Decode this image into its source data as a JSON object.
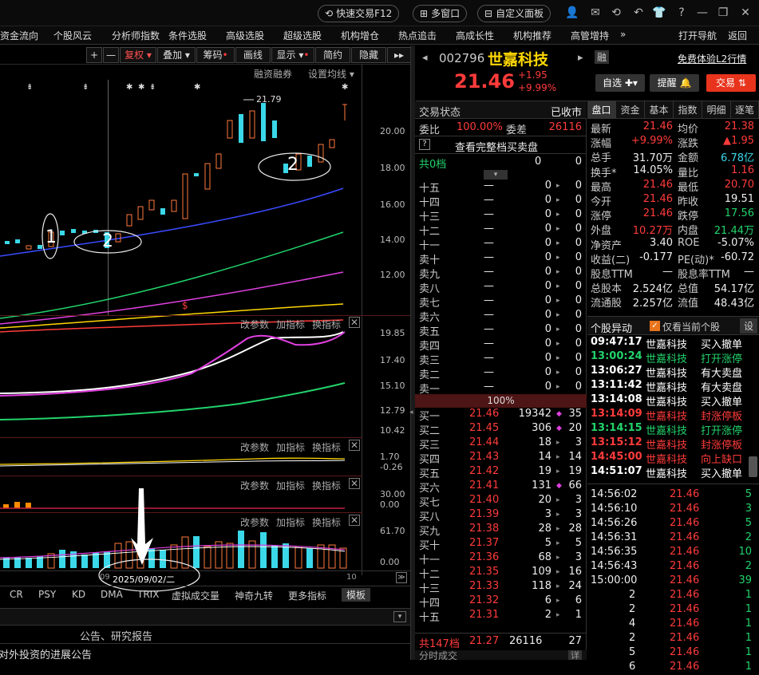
{
  "topbar": {
    "quick_trade": "快速交易F12",
    "multi_window": "多窗口",
    "custom_panel": "自定义面板"
  },
  "menu": [
    "资金流向",
    "个股风云",
    "分析师指数",
    "条件选股",
    "高级选股",
    "超级选股",
    "机构增仓",
    "热点追击",
    "高成长性",
    "机构推荐",
    "高管增持",
    "»",
    "打开导航",
    "返回"
  ],
  "chart_toolbar": {
    "plus": "+",
    "minus": "—",
    "fuquan": "复权",
    "overlay": "叠加",
    "chips": "筹码",
    "draw": "画线",
    "display": "显示",
    "simple": "简约",
    "hide": "隐藏",
    "more": "▸▸"
  },
  "chart_header": {
    "margin_trading": "融资融券",
    "ma_settings": "设置均线"
  },
  "price_axis": [
    "20.00",
    "18.00",
    "16.00",
    "14.00",
    "12.00"
  ],
  "annotations": {
    "high_label": "21.79",
    "dollar": "$",
    "circle1": "1",
    "circle2": "2"
  },
  "indicator_panels": [
    {
      "params": "改参数",
      "add": "加指标",
      "swap": "换指标",
      "axis": [
        "19.85",
        "17.40",
        "15.10",
        "12.79",
        "10.42"
      ]
    },
    {
      "params": "改参数",
      "add": "加指标",
      "swap": "换指标",
      "axis": [
        "1.70",
        "-0.26"
      ]
    },
    {
      "params": "改参数",
      "add": "加指标",
      "swap": "换指标",
      "axis": [
        "30.00",
        "0.00"
      ]
    },
    {
      "params": "改参数",
      "add": "加指标",
      "swap": "换指标",
      "axis": [
        "61.70",
        "0.00"
      ]
    }
  ],
  "x_axis": {
    "date_label": "2025/09/02/二",
    "right_label": "10",
    "left_label": "09"
  },
  "indicator_tabs": [
    "CR",
    "PSY",
    "KD",
    "DMA",
    "TRIX",
    "虚拟成交量",
    "神奇九转",
    "更多指标",
    "模板"
  ],
  "bottom_panel": {
    "title": "公告、研究报告",
    "item": "对外投资的进展公告"
  },
  "stock": {
    "code": "002796",
    "name": "世嘉科技",
    "tag": "融",
    "l2_link": "免费体验L2行情",
    "price": "21.46",
    "change": "+1.95",
    "change_pct": "+9.99%",
    "btn_watch": "自选",
    "btn_alert": "提醒",
    "btn_trade": "交易"
  },
  "order_book": {
    "status_label": "交易状态",
    "status_value": "已收市",
    "weibi_label": "委比",
    "weibi_value": "100.00%",
    "weicha_label": "委差",
    "weicha_value": "26116",
    "full_book_label": "查看完整档买卖盘",
    "sell_total_label": "共0档",
    "sell_total_v1": "0",
    "sell_total_v2": "0",
    "sells": [
      {
        "label": "十五",
        "price": "—",
        "vol": "0",
        "cnt": "0"
      },
      {
        "label": "十四",
        "price": "—",
        "vol": "0",
        "cnt": "0"
      },
      {
        "label": "十三",
        "price": "—",
        "vol": "0",
        "cnt": "0"
      },
      {
        "label": "十二",
        "price": "—",
        "vol": "0",
        "cnt": "0"
      },
      {
        "label": "十一",
        "price": "—",
        "vol": "0",
        "cnt": "0"
      },
      {
        "label": "卖十",
        "price": "—",
        "vol": "0",
        "cnt": "0"
      },
      {
        "label": "卖九",
        "price": "—",
        "vol": "0",
        "cnt": "0"
      },
      {
        "label": "卖八",
        "price": "—",
        "vol": "0",
        "cnt": "0"
      },
      {
        "label": "卖七",
        "price": "—",
        "vol": "0",
        "cnt": "0"
      },
      {
        "label": "卖六",
        "price": "—",
        "vol": "0",
        "cnt": "0"
      },
      {
        "label": "卖五",
        "price": "—",
        "vol": "0",
        "cnt": "0"
      },
      {
        "label": "卖四",
        "price": "—",
        "vol": "0",
        "cnt": "0"
      },
      {
        "label": "卖三",
        "price": "—",
        "vol": "0",
        "cnt": "0"
      },
      {
        "label": "卖二",
        "price": "—",
        "vol": "0",
        "cnt": "0"
      },
      {
        "label": "卖一",
        "price": "—",
        "vol": "0",
        "cnt": "0"
      }
    ],
    "ratio_bar": "100%",
    "buys": [
      {
        "label": "买一",
        "price": "21.46",
        "vol": "19342",
        "cnt": "35"
      },
      {
        "label": "买二",
        "price": "21.45",
        "vol": "306",
        "cnt": "20"
      },
      {
        "label": "买三",
        "price": "21.44",
        "vol": "18",
        "cnt": "3"
      },
      {
        "label": "买四",
        "price": "21.43",
        "vol": "14",
        "cnt": "14"
      },
      {
        "label": "买五",
        "price": "21.42",
        "vol": "19",
        "cnt": "19"
      },
      {
        "label": "买六",
        "price": "21.41",
        "vol": "131",
        "cnt": "66"
      },
      {
        "label": "买七",
        "price": "21.40",
        "vol": "20",
        "cnt": "3"
      },
      {
        "label": "买八",
        "price": "21.39",
        "vol": "3",
        "cnt": "3"
      },
      {
        "label": "买九",
        "price": "21.38",
        "vol": "28",
        "cnt": "28"
      },
      {
        "label": "买十",
        "price": "21.37",
        "vol": "5",
        "cnt": "5"
      },
      {
        "label": "十一",
        "price": "21.36",
        "vol": "68",
        "cnt": "3"
      },
      {
        "label": "十二",
        "price": "21.35",
        "vol": "109",
        "cnt": "16"
      },
      {
        "label": "十三",
        "price": "21.33",
        "vol": "118",
        "cnt": "24"
      },
      {
        "label": "十四",
        "price": "21.32",
        "vol": "6",
        "cnt": "6"
      },
      {
        "label": "十五",
        "price": "21.31",
        "vol": "2",
        "cnt": "1"
      }
    ],
    "buy_total_label": "共147档",
    "buy_total_price": "21.27",
    "buy_total_vol": "26116",
    "buy_total_cnt": "27",
    "tick_footer": "分时成交"
  },
  "quote_tabs": [
    "盘口",
    "资金",
    "基本",
    "指数",
    "明细",
    "逐笔"
  ],
  "quote": [
    {
      "l1": "最新",
      "v1": "21.46",
      "l2": "均价",
      "v2": "21.38"
    },
    {
      "l1": "涨幅",
      "v1": "+9.99%",
      "l2": "涨跌",
      "v2": "▲1.95"
    },
    {
      "l1": "总手",
      "v1": "31.70万",
      "l2": "金额",
      "v2": "6.78亿"
    },
    {
      "l1": "换手*",
      "v1": "14.05%",
      "l2": "量比",
      "v2": "1.16"
    },
    {
      "l1": "最高",
      "v1": "21.46",
      "l2": "最低",
      "v2": "20.70"
    },
    {
      "l1": "今开",
      "v1": "21.46",
      "l2": "昨收",
      "v2": "19.51"
    },
    {
      "l1": "涨停",
      "v1": "21.46",
      "l2": "跌停",
      "v2": "17.56"
    },
    {
      "l1": "外盘",
      "v1": "10.27万",
      "l2": "内盘",
      "v2": "21.44万"
    },
    {
      "l1": "净资产",
      "v1": "3.40",
      "l2": "ROE",
      "v2": "-5.07%"
    },
    {
      "l1": "收益(二)",
      "v1": "-0.177",
      "l2": "PE(动)*",
      "v2": "-60.72"
    },
    {
      "l1": "股息TTM",
      "v1": "—",
      "l2": "股息率TTM",
      "v2": "—"
    },
    {
      "l1": "总股本",
      "v1": "2.524亿",
      "l2": "总值",
      "v2": "54.17亿"
    },
    {
      "l1": "流通股",
      "v1": "2.257亿",
      "l2": "流值",
      "v2": "48.43亿"
    }
  ],
  "anomaly": {
    "title": "个股异动",
    "only_current": "仅看当前个股",
    "settings": "设",
    "rows": [
      {
        "time": "09:47:17",
        "name": "世嘉科技",
        "event": "买入撤单",
        "color": "#ffffff"
      },
      {
        "time": "13:00:24",
        "name": "世嘉科技",
        "event": "打开涨停",
        "color": "#22d36b"
      },
      {
        "time": "13:06:27",
        "name": "世嘉科技",
        "event": "有大卖盘",
        "color": "#ffffff"
      },
      {
        "time": "13:11:42",
        "name": "世嘉科技",
        "event": "有大卖盘",
        "color": "#ffffff"
      },
      {
        "time": "13:14:08",
        "name": "世嘉科技",
        "event": "买入撤单",
        "color": "#ffffff"
      },
      {
        "time": "13:14:09",
        "name": "世嘉科技",
        "event": "封涨停板",
        "color": "#ff3b3b"
      },
      {
        "time": "13:14:15",
        "name": "世嘉科技",
        "event": "打开涨停",
        "color": "#22d36b"
      },
      {
        "time": "13:15:12",
        "name": "世嘉科技",
        "event": "封涨停板",
        "color": "#ff3b3b"
      },
      {
        "time": "14:45:00",
        "name": "世嘉科技",
        "event": "向上缺口",
        "color": "#ff3b3b"
      },
      {
        "time": "14:51:07",
        "name": "世嘉科技",
        "event": "买入撤单",
        "color": "#ffffff"
      }
    ]
  },
  "ticks": [
    {
      "time": "14:56:02",
      "price": "21.46",
      "vol": "5"
    },
    {
      "time": "14:56:10",
      "price": "21.46",
      "vol": "3"
    },
    {
      "time": "14:56:26",
      "price": "21.46",
      "vol": "5"
    },
    {
      "time": "14:56:31",
      "price": "21.46",
      "vol": "2"
    },
    {
      "time": "14:56:35",
      "price": "21.46",
      "vol": "10"
    },
    {
      "time": "14:56:43",
      "price": "21.46",
      "vol": "2"
    },
    {
      "time": "15:00:00",
      "price": "21.46",
      "vol": "39"
    },
    {
      "time": "2",
      "price": "21.46",
      "vol": "1"
    },
    {
      "time": "2",
      "price": "21.46",
      "vol": "1"
    },
    {
      "time": "4",
      "price": "21.46",
      "vol": "1"
    },
    {
      "time": "2",
      "price": "21.46",
      "vol": "1"
    },
    {
      "time": "5",
      "price": "21.46",
      "vol": "1"
    },
    {
      "time": "6",
      "price": "21.46",
      "vol": "1"
    }
  ],
  "colors": {
    "up": "#ff3b3b",
    "down": "#22d36b",
    "accent": "#ffd700",
    "candle_down": "#3ad8e8",
    "trade_btn": "#e8341c"
  }
}
